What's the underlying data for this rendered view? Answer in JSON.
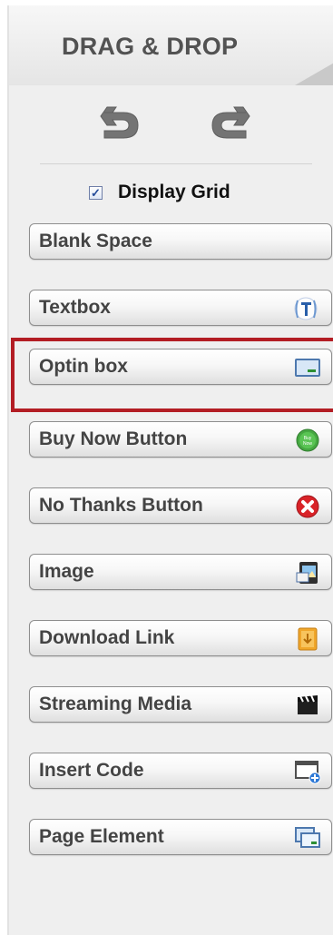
{
  "header": {
    "title": "DRAG & DROP"
  },
  "controls": {
    "undo": "undo-icon",
    "redo": "redo-icon",
    "display_grid": {
      "label": "Display Grid",
      "checked": true
    }
  },
  "buttons": [
    {
      "label": "Blank Space",
      "icon": "blank-space-icon"
    },
    {
      "label": "Textbox",
      "icon": "textbox-icon"
    },
    {
      "label": "Optin box",
      "icon": "optin-box-icon",
      "selected": true
    },
    {
      "label": "Buy Now Button",
      "icon": "buy-now-icon"
    },
    {
      "label": "No Thanks Button",
      "icon": "close-icon"
    },
    {
      "label": "Image",
      "icon": "image-icon"
    },
    {
      "label": "Download Link",
      "icon": "download-icon"
    },
    {
      "label": "Streaming Media",
      "icon": "video-icon"
    },
    {
      "label": "Insert Code",
      "icon": "insert-code-icon"
    },
    {
      "label": "Page Element",
      "icon": "page-element-icon"
    }
  ],
  "colors": {
    "panel_background": "#efefef",
    "button_text": "#444444",
    "selection_outline": "#b31d24",
    "buy_now_icon": "#46a842",
    "no_thanks_icon": "#d92328"
  }
}
